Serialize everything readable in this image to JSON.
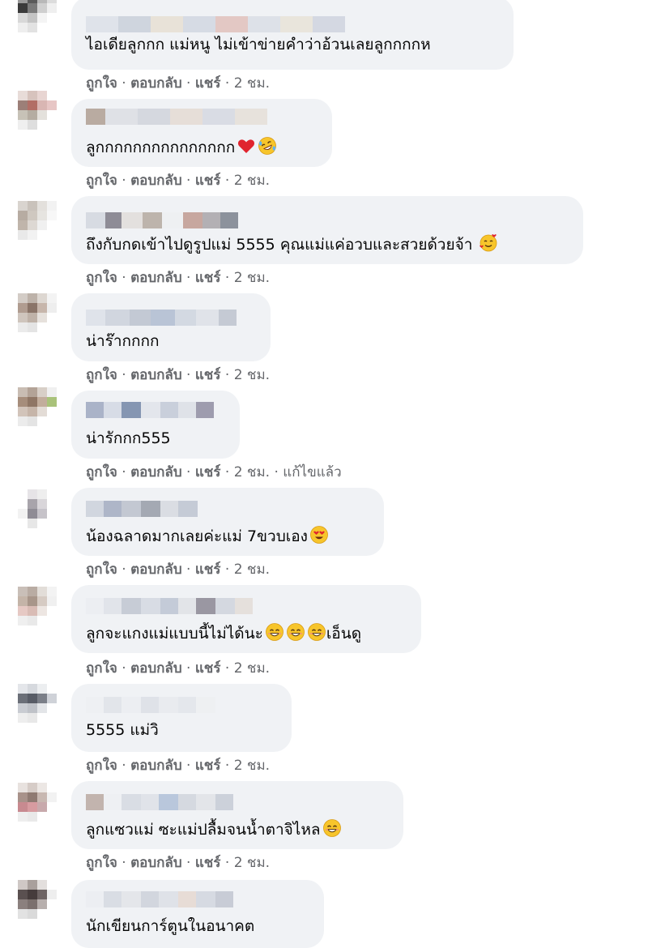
{
  "comments": [
    {
      "text": "ไอเดียลูกกก แม่หนู ไม่เข้าข่ายคำว่าอ้วนเลยลูกกกกห",
      "actions": {
        "like": "ถูกใจ",
        "reply": "ตอบกลับ",
        "share": "แชร์",
        "time": "2 ชม."
      }
    },
    {
      "text": "ลูกกกกกกกกกกกกกกก",
      "emoji": [
        "heart-icon",
        "rofl-face-icon"
      ],
      "actions": {
        "like": "ถูกใจ",
        "reply": "ตอบกลับ",
        "share": "แชร์",
        "time": "2 ชม."
      }
    },
    {
      "text": "ถึงกับกดเข้าไปดูรูปแม่ 5555 คุณแม่แค่อวบและสวยด้วยจ้า",
      "emoji": [
        "smiling-face-with-hearts-icon"
      ],
      "actions": {
        "like": "ถูกใจ",
        "reply": "ตอบกลับ",
        "share": "แชร์",
        "time": "2 ชม."
      }
    },
    {
      "text": "น่าร๊ากกกก",
      "actions": {
        "like": "ถูกใจ",
        "reply": "ตอบกลับ",
        "share": "แชร์",
        "time": "2 ชม."
      }
    },
    {
      "text": "น่ารักกก555",
      "actions": {
        "like": "ถูกใจ",
        "reply": "ตอบกลับ",
        "share": "แชร์",
        "time": "2 ชม.",
        "edited": "แก้ไขแล้ว"
      }
    },
    {
      "text": "น้องฉลาดมากเลยค่ะแม่ 7ขวบเอง",
      "emoji": [
        "heart-eyes-face-icon"
      ],
      "actions": {
        "like": "ถูกใจ",
        "reply": "ตอบกลับ",
        "share": "แชร์",
        "time": "2 ชม."
      }
    },
    {
      "text": "ลูกจะแกงแม่แบบนี้ไม่ได้นะ",
      "text_after": "เอ็นดู",
      "emoji": [
        "smiling-face-icon",
        "smiling-face-icon",
        "smiling-face-icon"
      ],
      "actions": {
        "like": "ถูกใจ",
        "reply": "ตอบกลับ",
        "share": "แชร์",
        "time": "2 ชม."
      }
    },
    {
      "text": "5555 แม่วิ",
      "actions": {
        "like": "ถูกใจ",
        "reply": "ตอบกลับ",
        "share": "แชร์",
        "time": "2 ชม."
      }
    },
    {
      "text": "ลูกแซวแม่ ซะแม่ปลื้มจนน้ำตาจิไหล",
      "emoji": [
        "smiling-face-icon"
      ],
      "actions": {
        "like": "ถูกใจ",
        "reply": "ตอบกลับ",
        "share": "แชร์",
        "time": "2 ชม."
      }
    },
    {
      "text": "นักเขียนการ์ตูนในอนาคต"
    }
  ],
  "colors": {
    "bubble": "#f0f2f5",
    "action_text": "#65676b",
    "text": "#050505"
  }
}
